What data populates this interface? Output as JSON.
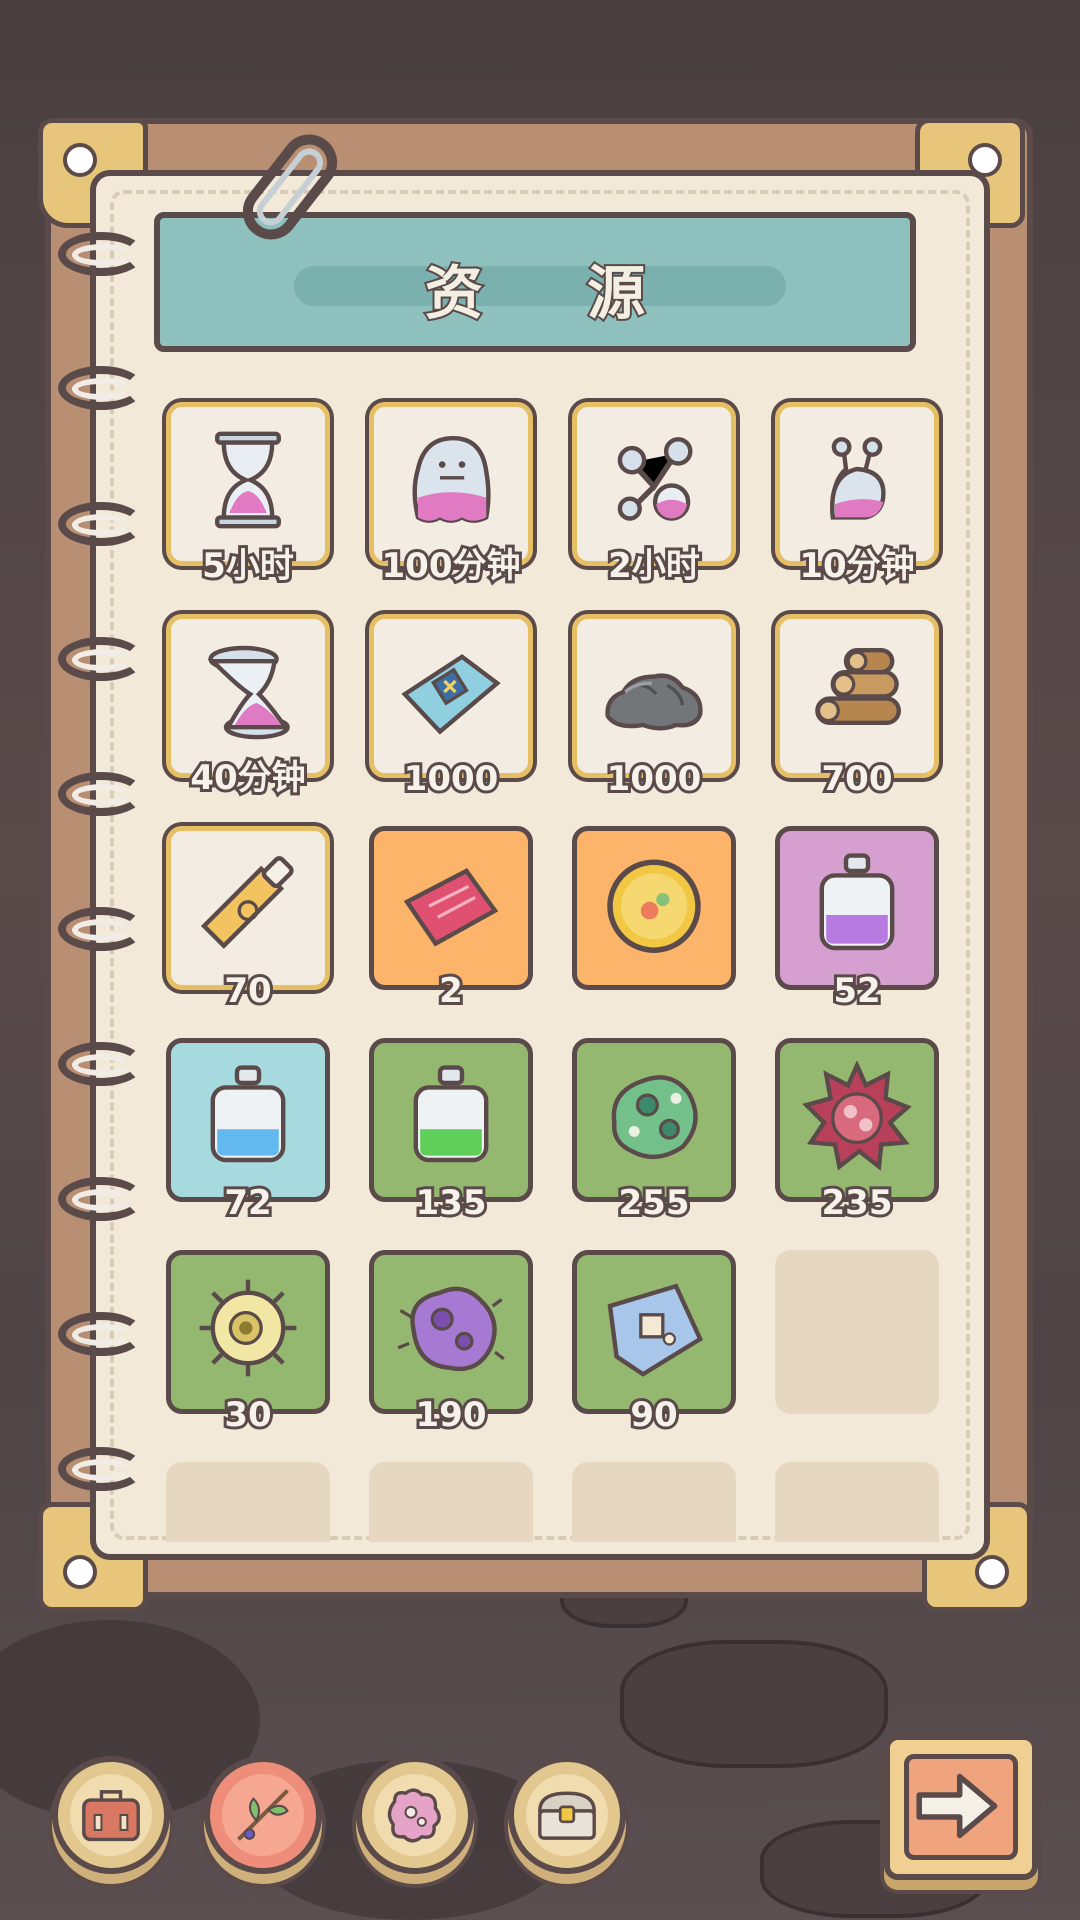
{
  "panel": {
    "title": "资 源"
  },
  "colors": {
    "panel_frame": "#b98f73",
    "paper": "#f2e9d8",
    "banner": "#8ec1bd",
    "slot_border": "#e6be63",
    "outline": "#5b4a4a"
  },
  "items": [
    {
      "icon": "hourglass-icon",
      "count": "5小时",
      "bg": "white"
    },
    {
      "icon": "ghost-potion-icon",
      "count": "100分钟",
      "bg": "white"
    },
    {
      "icon": "molecule-flask-icon",
      "count": "2小时",
      "bg": "white"
    },
    {
      "icon": "snail-potion-icon",
      "count": "10分钟",
      "bg": "white"
    },
    {
      "icon": "twisted-hourglass-icon",
      "count": "40分钟",
      "bg": "white"
    },
    {
      "icon": "blueprint-ticket-icon",
      "count": "1000",
      "bg": "white"
    },
    {
      "icon": "stone-icon",
      "count": "1000",
      "bg": "white"
    },
    {
      "icon": "wood-logs-icon",
      "count": "700",
      "bg": "white"
    },
    {
      "icon": "glue-tube-icon",
      "count": "70",
      "bg": "white"
    },
    {
      "icon": "red-ticket-icon",
      "count": "2",
      "bg": "orange"
    },
    {
      "icon": "coin-icon",
      "count": "",
      "bg": "orange"
    },
    {
      "icon": "purple-bottle-icon",
      "count": "52",
      "bg": "pink"
    },
    {
      "icon": "blue-bottle-icon",
      "count": "72",
      "bg": "blue"
    },
    {
      "icon": "green-bottle-icon",
      "count": "135",
      "bg": "green"
    },
    {
      "icon": "green-virus-icon",
      "count": "255",
      "bg": "green"
    },
    {
      "icon": "red-virus-icon",
      "count": "235",
      "bg": "green"
    },
    {
      "icon": "yellow-cell-icon",
      "count": "30",
      "bg": "green"
    },
    {
      "icon": "purple-bacteria-icon",
      "count": "190",
      "bg": "green"
    },
    {
      "icon": "blue-specimen-icon",
      "count": "90",
      "bg": "green"
    }
  ],
  "toolbar": {
    "buttons": [
      {
        "icon": "briefcase-icon"
      },
      {
        "icon": "herb-branch-icon"
      },
      {
        "icon": "puzzle-bone-icon"
      },
      {
        "icon": "treasure-chest-icon"
      }
    ],
    "next_icon": "arrow-right-icon"
  }
}
